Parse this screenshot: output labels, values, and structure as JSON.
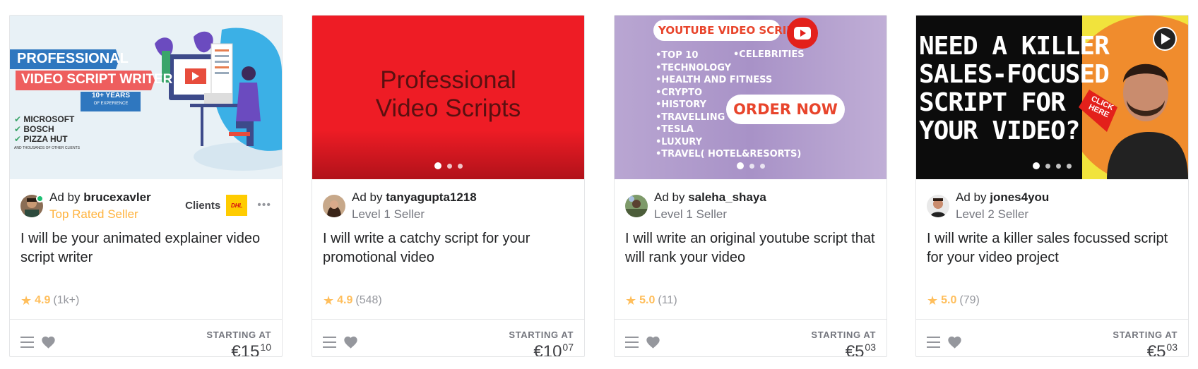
{
  "cards": [
    {
      "thumb_text": {
        "banner1": "PROFESSIONAL",
        "banner2": "VIDEO SCRIPT WRITER",
        "years": "10+ YEARS",
        "years_sub": "OF EXPERIENCE",
        "clients": [
          "MICROSOFT",
          "BOSCH",
          "PIZZA HUT"
        ],
        "clients_note": "AND THOUSANDS OF OTHER CLIENTS"
      },
      "ad_prefix": "Ad by",
      "seller": "brucexavler",
      "level": "Top Rated Seller",
      "clients_label": "Clients",
      "clients_logo": "DHL",
      "more": "•••",
      "title": "I will be your animated explainer video script writer",
      "rating": "4.9",
      "reviews": "(1k+)",
      "starting_label": "STARTING AT",
      "price_main": "€15",
      "price_cents": "10"
    },
    {
      "thumb_text": {
        "line1": "Professional",
        "line2": "Video Scripts"
      },
      "ad_prefix": "Ad by",
      "seller": "tanyagupta1218",
      "level": "Level 1 Seller",
      "title": "I will write a catchy script for your promotional video",
      "rating": "4.9",
      "reviews": "(548)",
      "starting_label": "STARTING AT",
      "price_main": "€10",
      "price_cents": "07"
    },
    {
      "thumb_text": {
        "header": "YOUTUBE VIDEO SCRIPTS",
        "list": [
          "•TOP 10",
          "•TECHNOLOGY",
          "•HEALTH AND FITNESS",
          "•CRYPTO",
          "•HISTORY",
          "•TRAVELLING",
          "•TESLA",
          "•LUXURY",
          "•TRAVEL( HOTEL&RESORTS)"
        ],
        "celebs": "•CELEBRITIES",
        "order": "ORDER NOW"
      },
      "ad_prefix": "Ad by",
      "seller": "saleha_shaya",
      "level": "Level 1 Seller",
      "title": "I will write an original youtube script that will rank your video",
      "rating": "5.0",
      "reviews": "(11)",
      "starting_label": "STARTING AT",
      "price_main": "€5",
      "price_cents": "03"
    },
    {
      "thumb_text": {
        "lines": [
          "NEED A KILLER",
          "SALES-FOCUSED",
          "SCRIPT FOR",
          "YOUR VIDEO?"
        ],
        "click": "CLICK HERE"
      },
      "ad_prefix": "Ad by",
      "seller": "jones4you",
      "level": "Level 2 Seller",
      "title": "I will write a killer sales focussed script for your video project",
      "rating": "5.0",
      "reviews": "(79)",
      "starting_label": "STARTING AT",
      "price_main": "€5",
      "price_cents": "03"
    }
  ],
  "icons": {
    "star": "star-icon",
    "menu": "menu-icon",
    "heart": "heart-icon",
    "play": "play-icon"
  },
  "colors": {
    "star": "#ffbe5b",
    "top_rated": "#ffb33e",
    "online": "#1dbf73",
    "thumb2_red": "#ee1c25"
  }
}
